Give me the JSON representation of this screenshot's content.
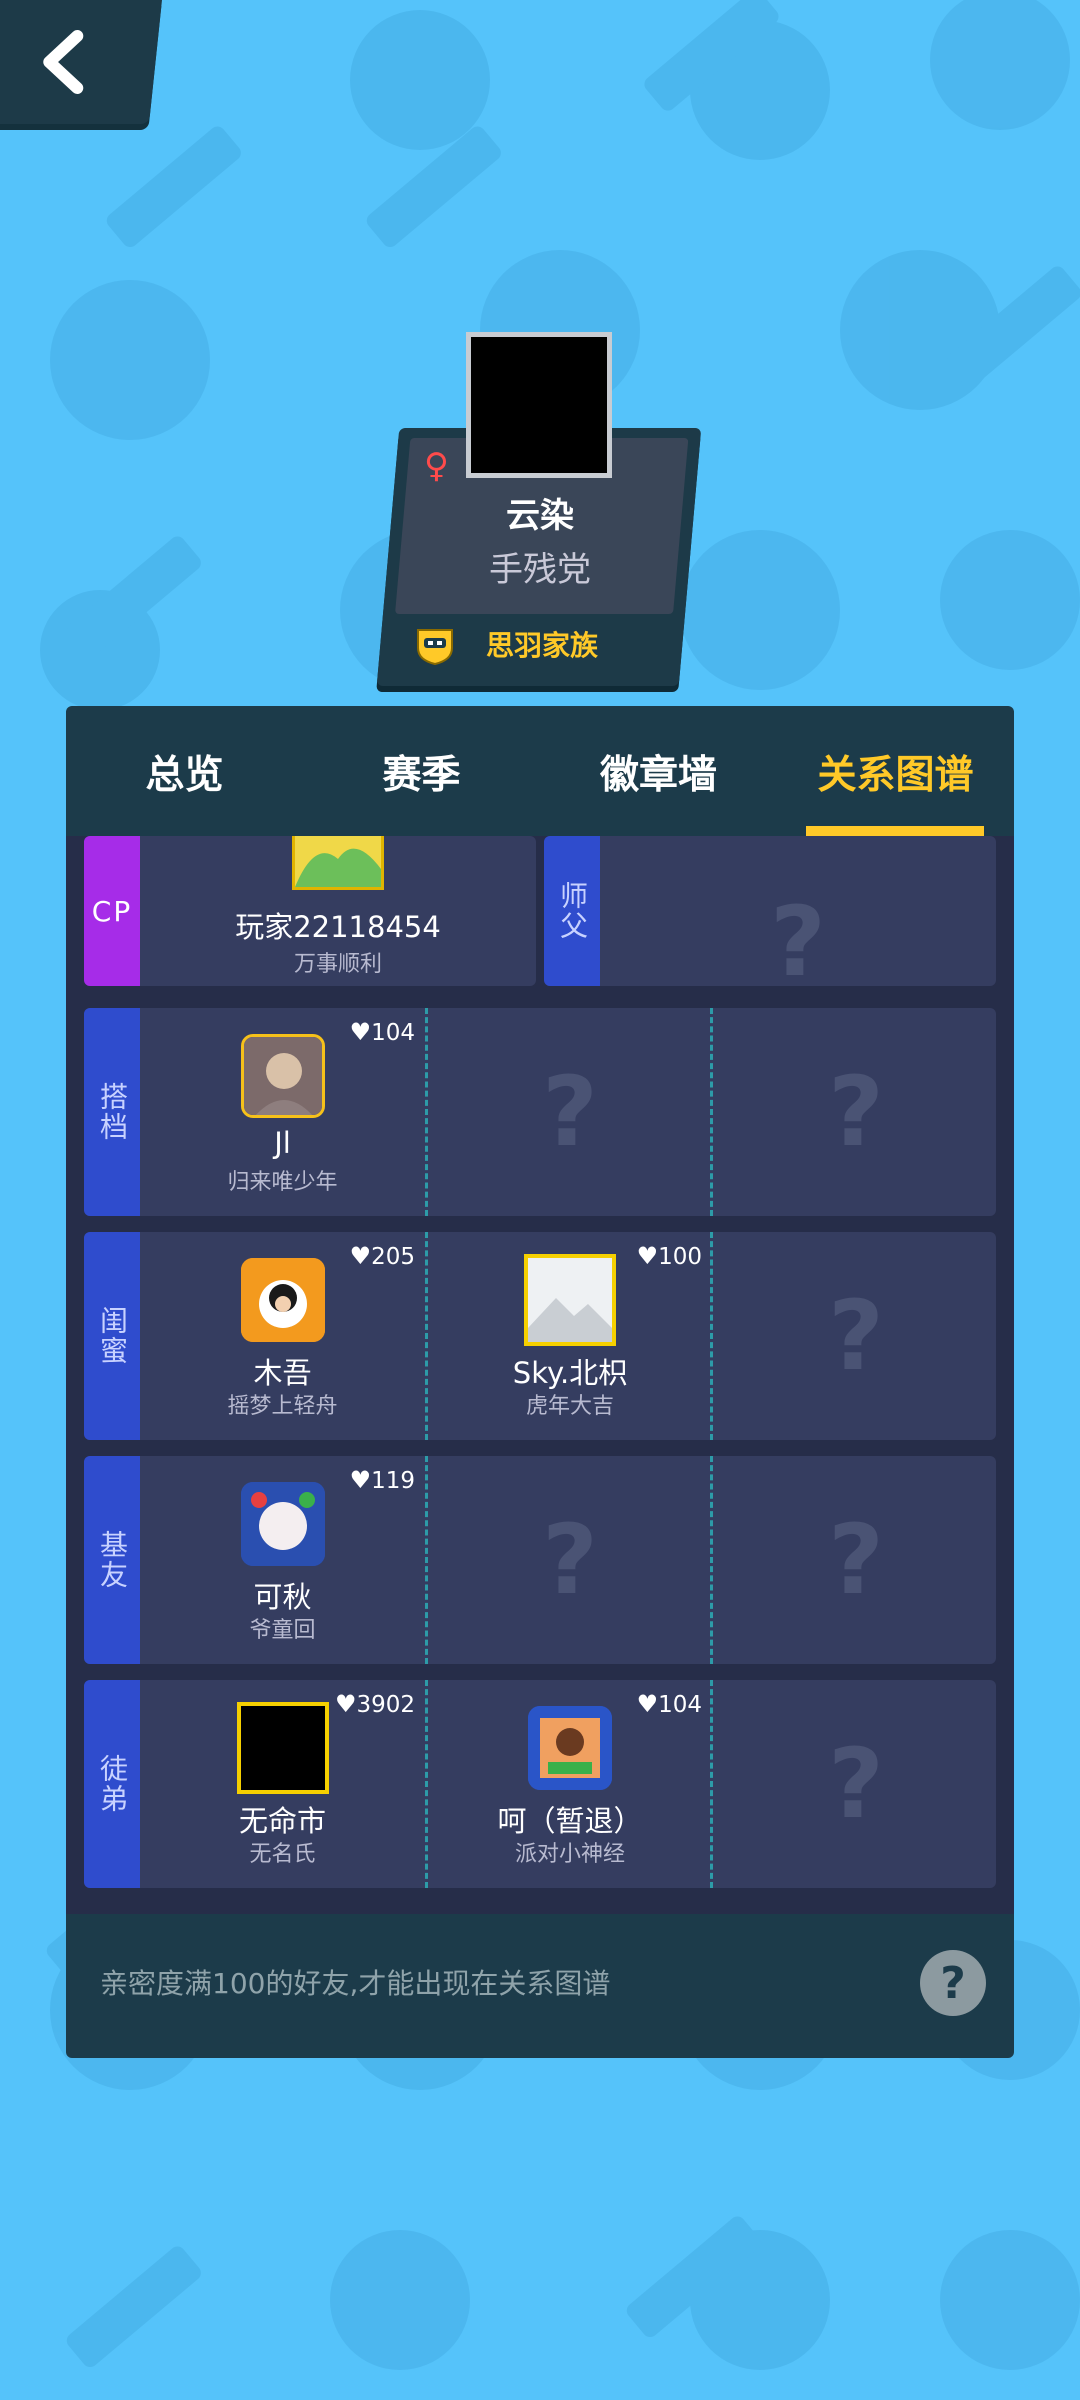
{
  "header": {
    "back_icon": "back-chevron-icon"
  },
  "profile": {
    "gender_icon": "♀",
    "nickname": "云染",
    "title": "手残党",
    "family_name": "思羽家族",
    "family_icon": "family-badge-icon"
  },
  "tabs": [
    {
      "label": "总览"
    },
    {
      "label": "赛季"
    },
    {
      "label": "徽章墙"
    },
    {
      "label": "关系图谱",
      "active": true
    }
  ],
  "relations": {
    "cp": {
      "label": "CP",
      "name": "玩家22118454",
      "sub": "万事顺利"
    },
    "master": {
      "label": "师父"
    },
    "partner": {
      "label": "搭档",
      "friends": [
        {
          "name": "Jl",
          "sub": "归来唯少年",
          "intimacy": "104"
        }
      ]
    },
    "bestie": {
      "label": "闺蜜",
      "friends": [
        {
          "name": "木吾",
          "sub": "摇梦上轻舟",
          "intimacy": "205"
        },
        {
          "name": "Sky.北枳",
          "sub": "虎年大吉",
          "intimacy": "100"
        }
      ]
    },
    "buddy": {
      "label": "基友",
      "friends": [
        {
          "name": "可秋",
          "sub": "爷童回",
          "intimacy": "119"
        }
      ]
    },
    "apprentice": {
      "label": "徒弟",
      "friends": [
        {
          "name": "无命市",
          "sub": "无名氏",
          "intimacy": "3902"
        },
        {
          "name": "呵（暂退）",
          "sub": "派对小神经",
          "intimacy": "104"
        }
      ]
    }
  },
  "question_mark": "?",
  "heart_icon": "♥",
  "footer": {
    "tip": "亲密度满100的好友,才能出现在关系图谱",
    "help": "?"
  },
  "colors": {
    "background": "#55c3fa",
    "panel": "#1c3b4a",
    "accent": "#ffc928",
    "row_label": "#2f4ccd"
  }
}
